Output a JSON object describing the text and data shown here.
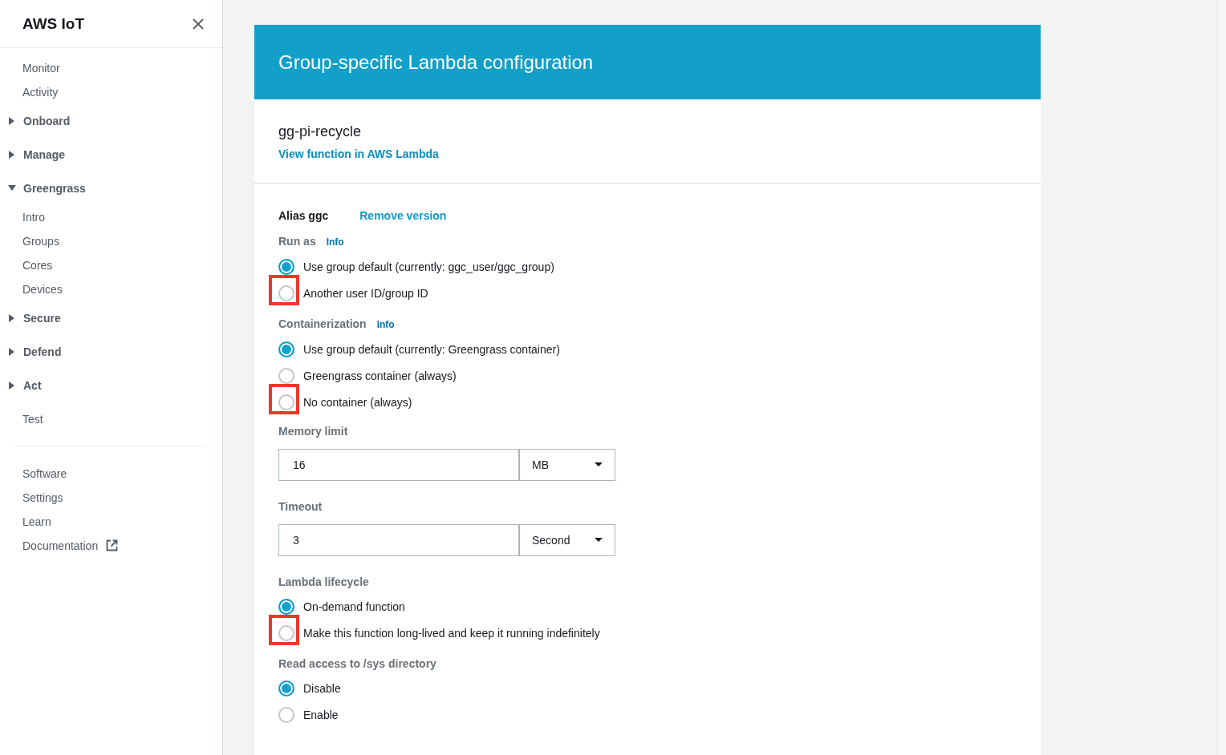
{
  "sidebar": {
    "title": "AWS IoT",
    "nav": [
      {
        "kind": "link",
        "label": "Monitor"
      },
      {
        "kind": "link",
        "label": "Activity"
      },
      {
        "kind": "section",
        "label": "Onboard",
        "expanded": false
      },
      {
        "kind": "section",
        "label": "Manage",
        "expanded": false
      },
      {
        "kind": "section",
        "label": "Greengrass",
        "expanded": true,
        "children": [
          {
            "label": "Intro"
          },
          {
            "label": "Groups"
          },
          {
            "label": "Cores"
          },
          {
            "label": "Devices"
          }
        ]
      },
      {
        "kind": "section",
        "label": "Secure",
        "expanded": false
      },
      {
        "kind": "section",
        "label": "Defend",
        "expanded": false
      },
      {
        "kind": "section",
        "label": "Act",
        "expanded": false
      },
      {
        "kind": "link",
        "label": "Test"
      }
    ],
    "footer": [
      {
        "label": "Software",
        "external": false
      },
      {
        "label": "Settings",
        "external": false
      },
      {
        "label": "Learn",
        "external": false
      },
      {
        "label": "Documentation",
        "external": true
      }
    ]
  },
  "card": {
    "title": "Group-specific Lambda configuration",
    "function_name": "gg-pi-recycle",
    "function_link": "View function in AWS Lambda",
    "alias": {
      "label": "Alias ggc",
      "link": "Remove version"
    },
    "groups": [
      {
        "kind": "radio",
        "label": "Run as",
        "info": "Info",
        "options": [
          {
            "label": "Use group default (currently: ggc_user/ggc_group)",
            "selected": true,
            "highlighted": false
          },
          {
            "label": "Another user ID/group ID",
            "selected": false,
            "highlighted": true
          }
        ]
      },
      {
        "kind": "radio",
        "label": "Containerization",
        "info": "Info",
        "options": [
          {
            "label": "Use group default (currently: Greengrass container)",
            "selected": true,
            "highlighted": false
          },
          {
            "label": "Greengrass container (always)",
            "selected": false,
            "highlighted": false
          },
          {
            "label": "No container (always)",
            "selected": false,
            "highlighted": true
          }
        ]
      },
      {
        "kind": "input",
        "label": "Memory limit",
        "value": "16",
        "unit": "MB"
      },
      {
        "kind": "input",
        "label": "Timeout",
        "value": "3",
        "unit": "Second"
      },
      {
        "kind": "radio",
        "label": "Lambda lifecycle",
        "options": [
          {
            "label": "On-demand function",
            "selected": true,
            "highlighted": false
          },
          {
            "label": "Make this function long-lived and keep it running indefinitely",
            "selected": false,
            "highlighted": true
          }
        ]
      },
      {
        "kind": "radio",
        "label": "Read access to /sys directory",
        "options": [
          {
            "label": "Disable",
            "selected": true,
            "highlighted": false
          },
          {
            "label": "Enable",
            "selected": false,
            "highlighted": false
          }
        ]
      }
    ]
  }
}
